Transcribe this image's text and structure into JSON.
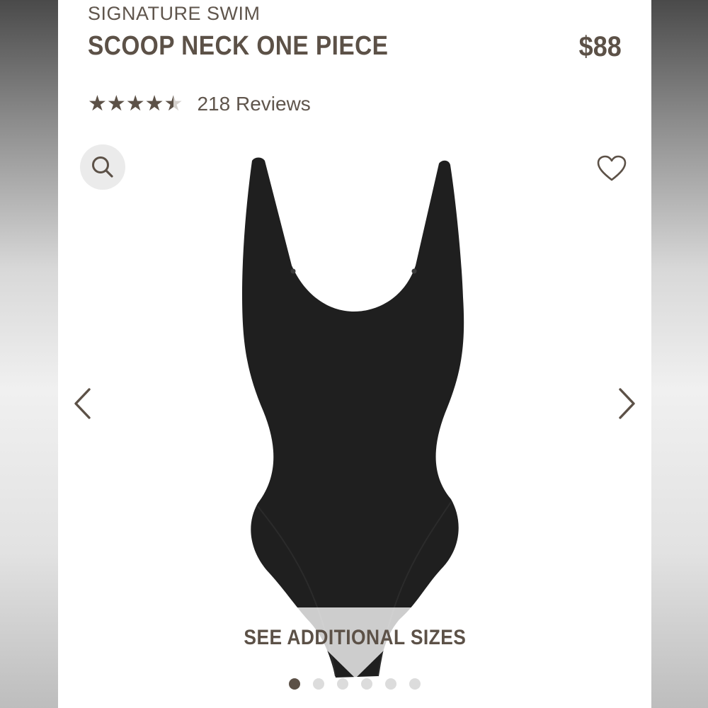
{
  "product": {
    "collection": "SIGNATURE SWIM",
    "name": "SCOOP NECK ONE PIECE",
    "price": "$88",
    "rating": 4.5,
    "rating_max": 5,
    "reviews_label": "218 Reviews",
    "image_alt": "black scoop neck one piece swimsuit"
  },
  "icons": {
    "zoom": "search-icon",
    "wishlist": "heart-icon",
    "prev": "chevron-left-icon",
    "next": "chevron-right-icon",
    "stars": "star-icon"
  },
  "gallery": {
    "sizes_label": "SEE ADDITIONAL SIZES",
    "slide_count": 6,
    "active_slide": 1
  },
  "colors": {
    "accent": "#5c5147",
    "garment": "#1e1e1e",
    "dot_inactive": "#dcdcdc"
  }
}
